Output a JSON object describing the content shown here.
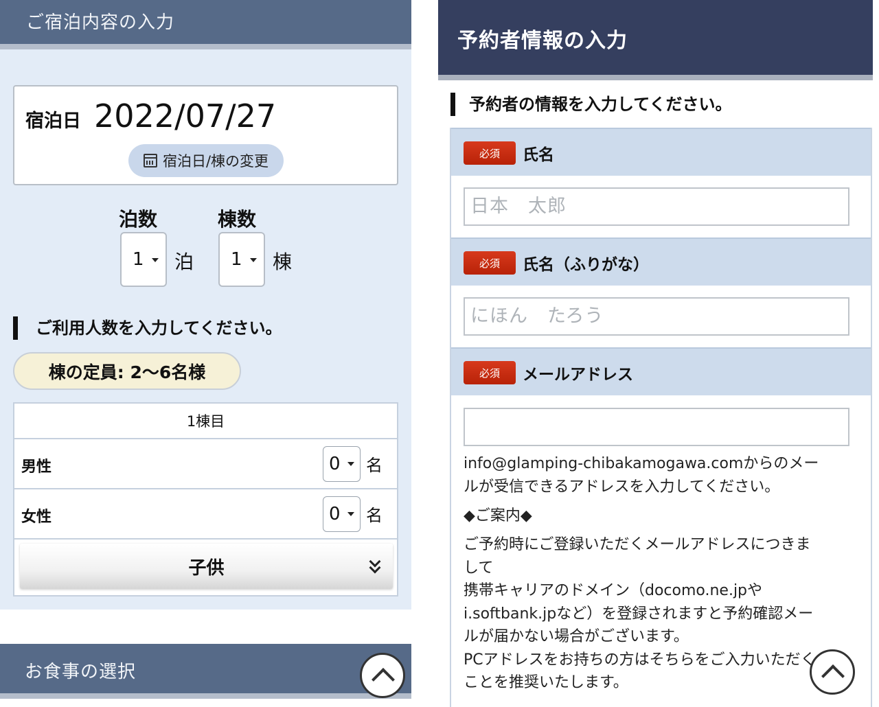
{
  "left": {
    "header_title": "ご宿泊内容の入力",
    "date_label": "宿泊日",
    "date_value": "2022/07/27",
    "change_button": "宿泊日/棟の変更",
    "nights": {
      "label": "泊数",
      "value": "1",
      "unit": "泊"
    },
    "buildings": {
      "label": "棟数",
      "value": "1",
      "unit": "棟"
    },
    "guests_section_title": "ご利用人数を入力してください。",
    "capacity": "棟の定員: 2〜6名様",
    "table": {
      "header": "1棟目",
      "rows": [
        {
          "label": "男性",
          "value": "0",
          "unit": "名"
        },
        {
          "label": "女性",
          "value": "0",
          "unit": "名"
        }
      ],
      "children_button": "子供"
    },
    "meal_header_title": "お食事の選択"
  },
  "right": {
    "header_title": "予約者情報の入力",
    "section_title": "予約者の情報を入力してください。",
    "required_badge": "必須",
    "fields": [
      {
        "label": "氏名",
        "placeholder": "日本　太郎",
        "value": ""
      },
      {
        "label": "氏名（ふりがな）",
        "placeholder": "にほん　たろう",
        "value": ""
      },
      {
        "label": "メールアドレス",
        "placeholder": "",
        "value": ""
      }
    ],
    "notes": {
      "line1": "info@glamping-chibakamogawa.comからのメー",
      "line2": "ルが受信できるアドレスを入力してください。",
      "guide": "◆ご案内◆",
      "line3": "ご予約時にご登録いただくメールアドレスにつきま",
      "line4": "して",
      "line5": "携帯キャリアのドメイン（docomo.ne.jpや",
      "line6": "i.softbank.jpなど）を登録されますと予約確認メー",
      "line7": "ルが届かない場合がございます。",
      "line8": "PCアドレスをお持ちの方はそちらをご入力いただく",
      "line9": "ことを推奨いたします。"
    }
  },
  "icons": {
    "calendar": "calendar-icon",
    "back_to_top": "chevron-up-icon",
    "expand": "double-chevron-down-icon"
  },
  "colors": {
    "left_header_bg": "#566a88",
    "right_header_bg": "#353f5f",
    "panel_bg": "#e3ecf7",
    "required_badge": "#c52a0f",
    "label_row_bg": "#cddbec",
    "capacity_bg": "#f6f1d7"
  }
}
